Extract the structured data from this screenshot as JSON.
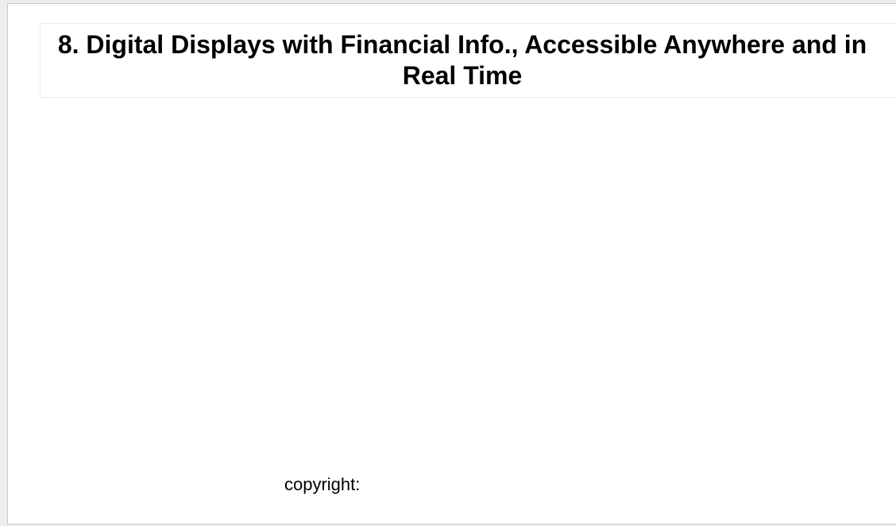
{
  "slide": {
    "title": "8. Digital Displays with Financial Info., Accessible Anywhere and in Real Time",
    "footer_text": "copyright:"
  },
  "colors": {
    "canvas_background": "#ffffff",
    "workspace_background": "#ededed",
    "text": "#000000"
  }
}
